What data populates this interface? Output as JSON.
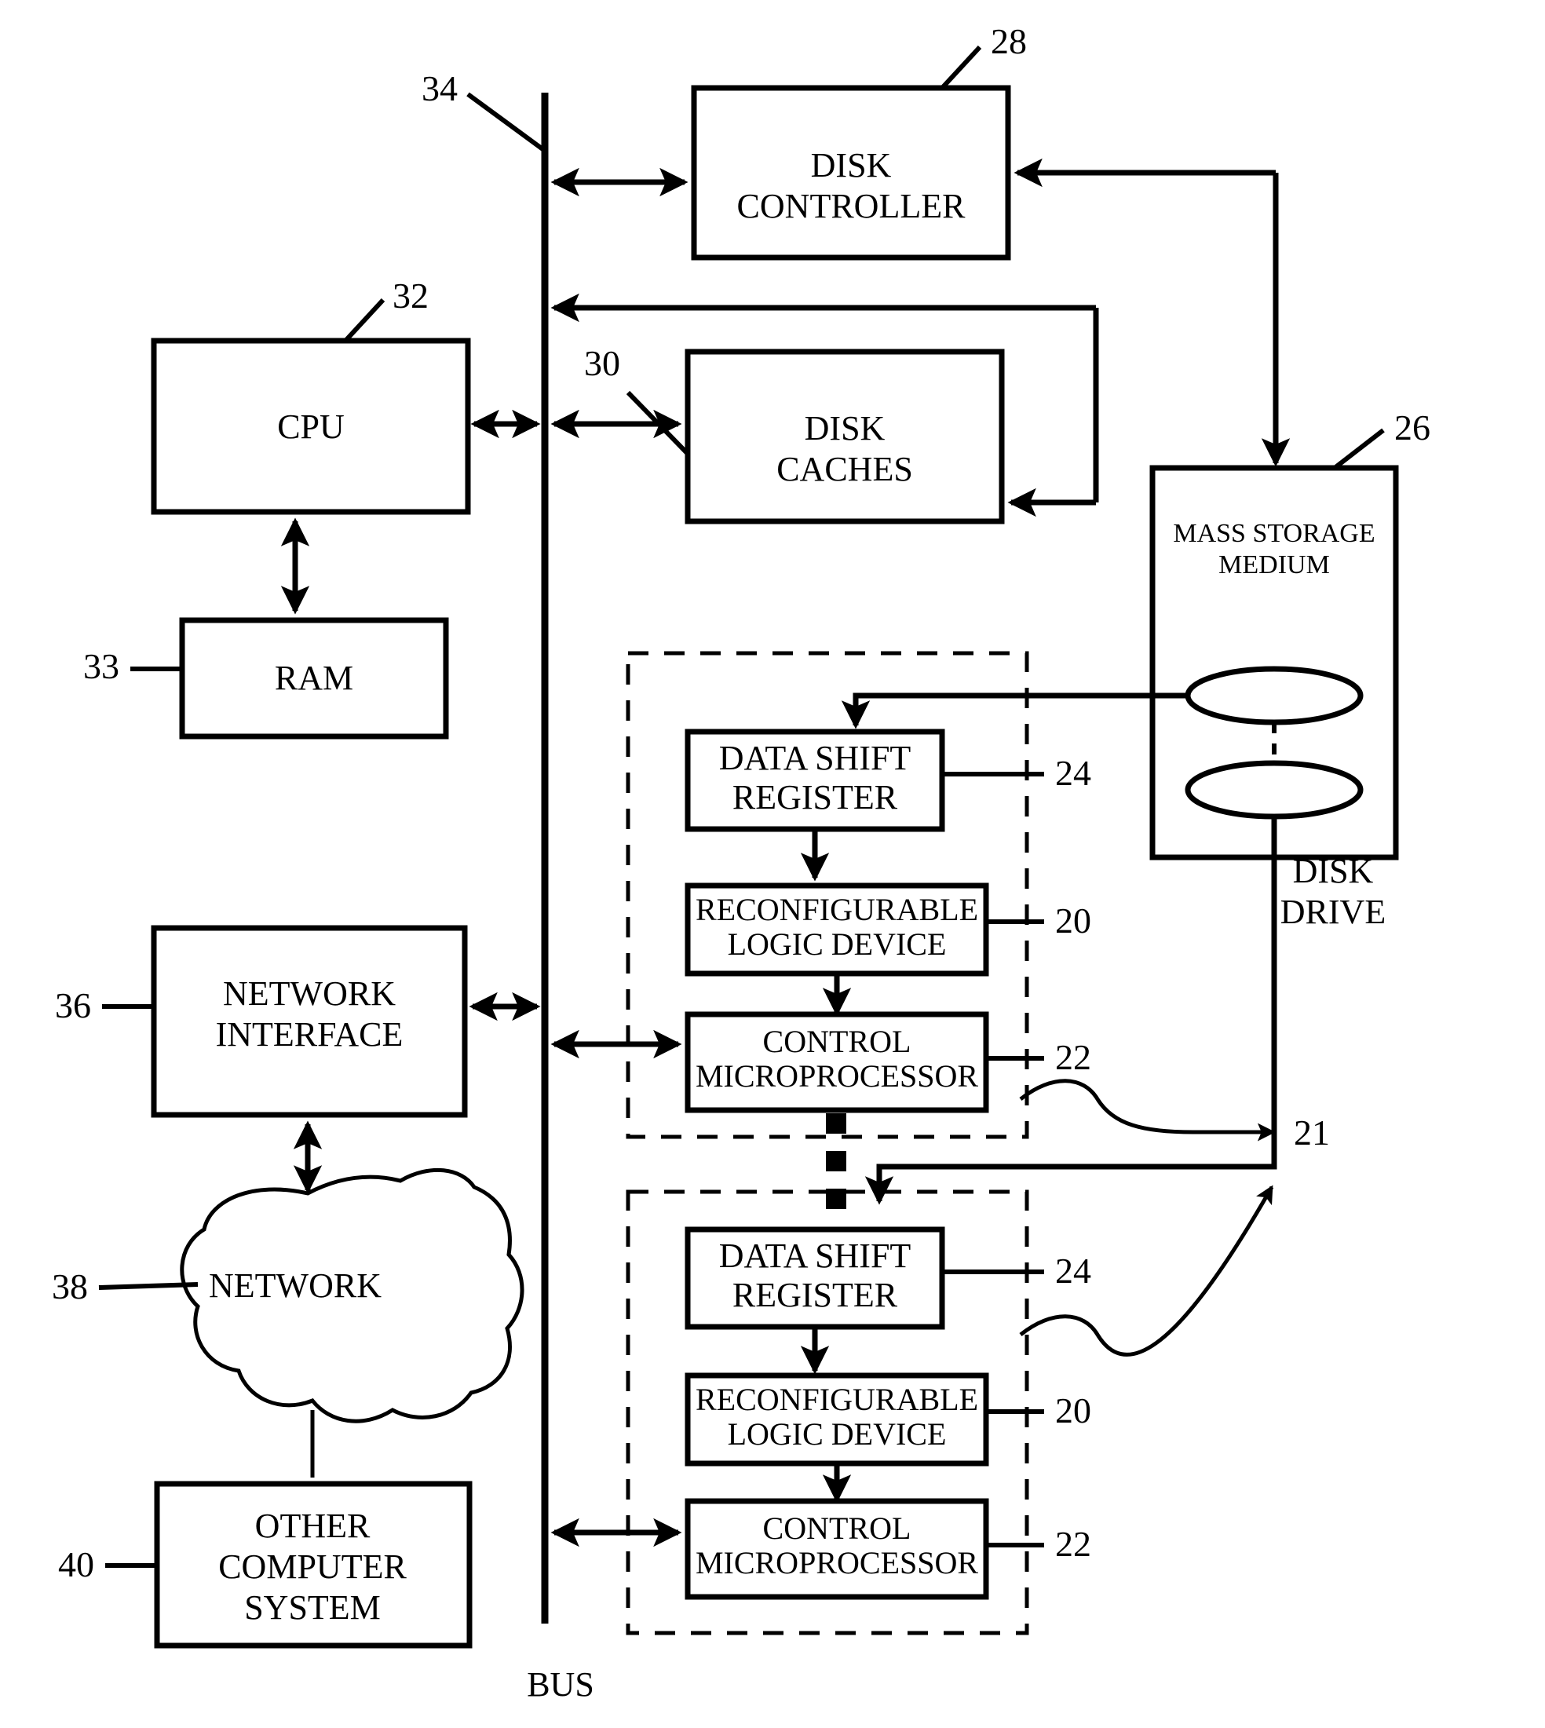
{
  "figure": {
    "type": "patent-block-diagram",
    "bus_label": "BUS"
  },
  "blocks": {
    "disk_controller": {
      "line1": "DISK",
      "line2": "CONTROLLER",
      "ref": "28"
    },
    "cpu": {
      "line1": "CPU",
      "ref": "32"
    },
    "ram": {
      "line1": "RAM",
      "ref": "33"
    },
    "disk_caches": {
      "line1": "DISK",
      "line2": "CACHES",
      "ref": "30"
    },
    "mass_storage": {
      "line1": "MASS STORAGE",
      "line2": "MEDIUM",
      "ref": "26"
    },
    "disk_drive": {
      "line1": "DISK",
      "line2": "DRIVE"
    },
    "network_interface": {
      "line1": "NETWORK",
      "line2": "INTERFACE",
      "ref": "36"
    },
    "network": {
      "line1": "NETWORK",
      "ref": "38"
    },
    "other_computer_system": {
      "line1": "OTHER",
      "line2": "COMPUTER",
      "line3": "SYSTEM",
      "ref": "40"
    }
  },
  "module_upper": {
    "ref": "21",
    "data_shift_register": {
      "line1": "DATA SHIFT",
      "line2": "REGISTER",
      "ref": "24"
    },
    "reconfigurable_logic_device": {
      "line1": "RECONFIGURABLE",
      "line2": "LOGIC DEVICE",
      "ref": "20"
    },
    "control_microprocessor": {
      "line1": "CONTROL",
      "line2": "MICROPROCESSOR",
      "ref": "22"
    }
  },
  "module_lower": {
    "ref": "21",
    "data_shift_register": {
      "line1": "DATA SHIFT",
      "line2": "REGISTER",
      "ref": "24"
    },
    "reconfigurable_logic_device": {
      "line1": "RECONFIGURABLE",
      "line2": "LOGIC DEVICE",
      "ref": "20"
    },
    "control_microprocessor": {
      "line1": "CONTROL",
      "line2": "MICROPROCESSOR",
      "ref": "22"
    }
  },
  "refs": {
    "bus": "34",
    "module": "21"
  },
  "colors": {
    "ink": "#000000",
    "paper": "#ffffff"
  }
}
